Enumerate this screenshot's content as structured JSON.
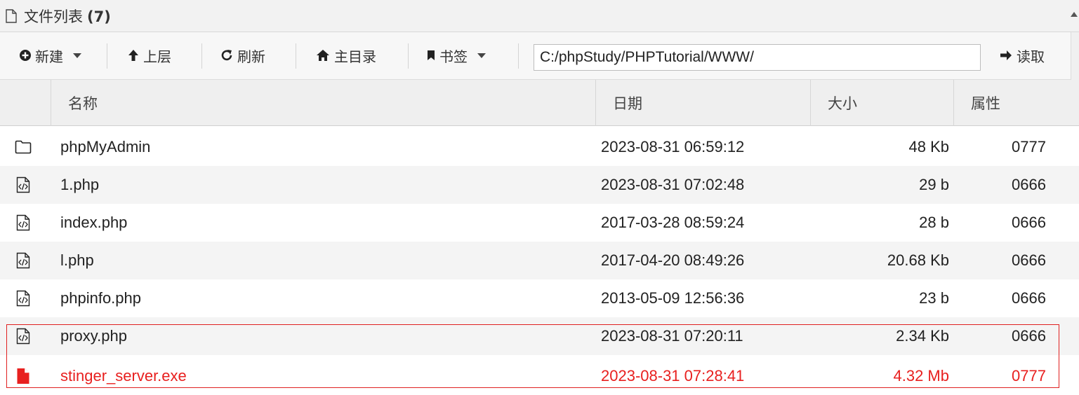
{
  "panel": {
    "title": "文件列表",
    "count": "(7)",
    "icon": "file-outline-icon"
  },
  "toolbar": {
    "new_label": "新建",
    "up_label": "上层",
    "refresh_label": "刷新",
    "home_label": "主目录",
    "bookmark_label": "书签",
    "path_value": "C:/phpStudy/PHPTutorial/WWW/",
    "read_label": "读取"
  },
  "table": {
    "columns": [
      "名称",
      "日期",
      "大小",
      "属性"
    ],
    "rows": [
      {
        "name": "phpMyAdmin",
        "date": "2023-08-31 06:59:12",
        "size": "48 Kb",
        "attr": "0777",
        "icon": "folder-icon"
      },
      {
        "name": "1.php",
        "date": "2023-08-31 07:02:48",
        "size": "29 b",
        "attr": "0666",
        "icon": "code-file-icon"
      },
      {
        "name": "index.php",
        "date": "2017-03-28 08:59:24",
        "size": "28 b",
        "attr": "0666",
        "icon": "code-file-icon"
      },
      {
        "name": "l.php",
        "date": "2017-04-20 08:49:26",
        "size": "20.68 Kb",
        "attr": "0666",
        "icon": "code-file-icon"
      },
      {
        "name": "phpinfo.php",
        "date": "2013-05-09 12:56:36",
        "size": "23 b",
        "attr": "0666",
        "icon": "code-file-icon"
      },
      {
        "name": "proxy.php",
        "date": "2023-08-31 07:20:11",
        "size": "2.34 Kb",
        "attr": "0666",
        "icon": "code-file-icon"
      },
      {
        "name": "stinger_server.exe",
        "date": "2023-08-31 07:28:41",
        "size": "4.32 Mb",
        "attr": "0777",
        "icon": "red-file-icon"
      }
    ]
  },
  "colors": {
    "danger": "#e8201f",
    "highlight_border": "#e02020"
  }
}
